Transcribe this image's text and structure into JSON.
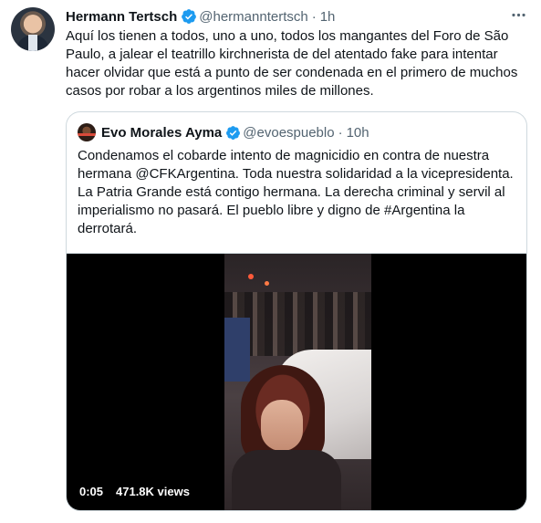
{
  "tweet": {
    "author": {
      "name": "Hermann Tertsch",
      "handle": "@hermanntertsch",
      "time": "1h"
    },
    "separator": "·",
    "text": "Aquí los tienen a todos, uno a uno, todos los mangantes del Foro de São Paulo, a jalear el teatrillo kirchnerista de del atentado fake para intentar hacer olvidar que está a punto de ser condenada en el primero de muchos casos por robar a los argentinos miles de millones.",
    "more_icon": "more-horizontal-icon"
  },
  "quoted": {
    "author": {
      "name": "Evo Morales Ayma",
      "handle": "@evoespueblo",
      "time": "10h"
    },
    "text": "Condenamos el cobarde intento de magnicidio en contra de nuestra hermana @CFKArgentina. Toda nuestra solidaridad a la vicepresidenta. La Patria Grande está contigo hermana. La derecha criminal y servil al imperialismo no pasará. El pueblo libre y digno de #Argentina la derrotará.",
    "video": {
      "duration": "0:05",
      "views": "471.8K views"
    }
  },
  "colors": {
    "verified": "#1d9bf0",
    "secondary_text": "#536471",
    "border": "#cfd9de"
  }
}
